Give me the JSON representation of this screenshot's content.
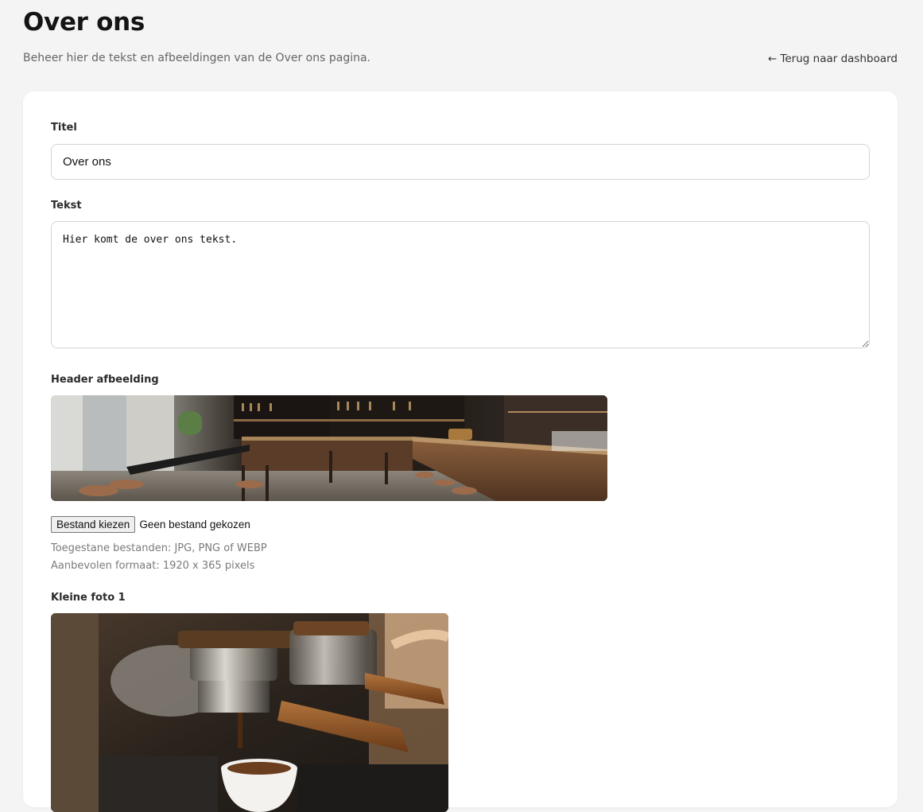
{
  "header": {
    "title": "Over ons",
    "subtitle": "Beheer hier de tekst en afbeeldingen van de Over ons pagina.",
    "back_link": "← Terug naar dashboard"
  },
  "form": {
    "title_label": "Titel",
    "title_value": "Over ons",
    "text_label": "Tekst",
    "text_value": "Hier komt de over ons tekst.",
    "header_image_label": "Header afbeelding",
    "file_button": "Bestand kiezen",
    "file_status": "Geen bestand gekozen",
    "help_allowed": "Toegestane bestanden: JPG, PNG of WEBP",
    "help_format": "Aanbevolen formaat: 1920 x 365 pixels",
    "small_photo_label": "Kleine foto 1"
  }
}
